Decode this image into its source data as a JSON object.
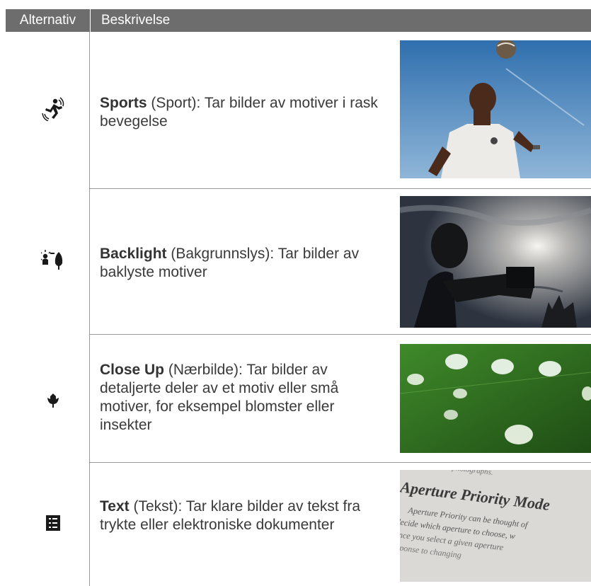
{
  "header": {
    "option_label": "Alternativ",
    "description_label": "Beskrivelse"
  },
  "rows": [
    {
      "name": "Sports",
      "native": " (Sport): Tar bilder av motiver i rask bevegelse",
      "icon": "sports-mode-icon",
      "photo": "soccer-player-heading-ball-photo"
    },
    {
      "name": "Backlight",
      "native": " (Bakgrunnslys): Tar bilder av baklyste motiver",
      "icon": "backlight-mode-icon",
      "photo": "backlit-photographer-silhouette-photo"
    },
    {
      "name": "Close Up",
      "native": " (Nærbilde): Tar bilder av detaljerte deler av et motiv eller små motiver, for eksempel blomster eller insekter",
      "icon": "close-up-flower-icon",
      "photo": "water-droplets-on-leaf-photo"
    },
    {
      "name": "Text",
      "native": " (Tekst): Tar klare bilder av tekst fra trykte eller elektroniske dokumenter",
      "icon": "text-document-icon",
      "photo": "book-page-aperture-priority-photo"
    }
  ],
  "book_page": {
    "line0": "of your photographs.",
    "heading": "Aperture Priority Mode",
    "line1": "Aperture Priority can be thought of",
    "line2": "decide which aperture to choose, w",
    "line3": "Once you select a given aperture",
    "line4": "response to changing"
  },
  "colors": {
    "header_bg": "#6d6d6d",
    "rule": "#9a9a9a",
    "text": "#3a3a3a"
  }
}
